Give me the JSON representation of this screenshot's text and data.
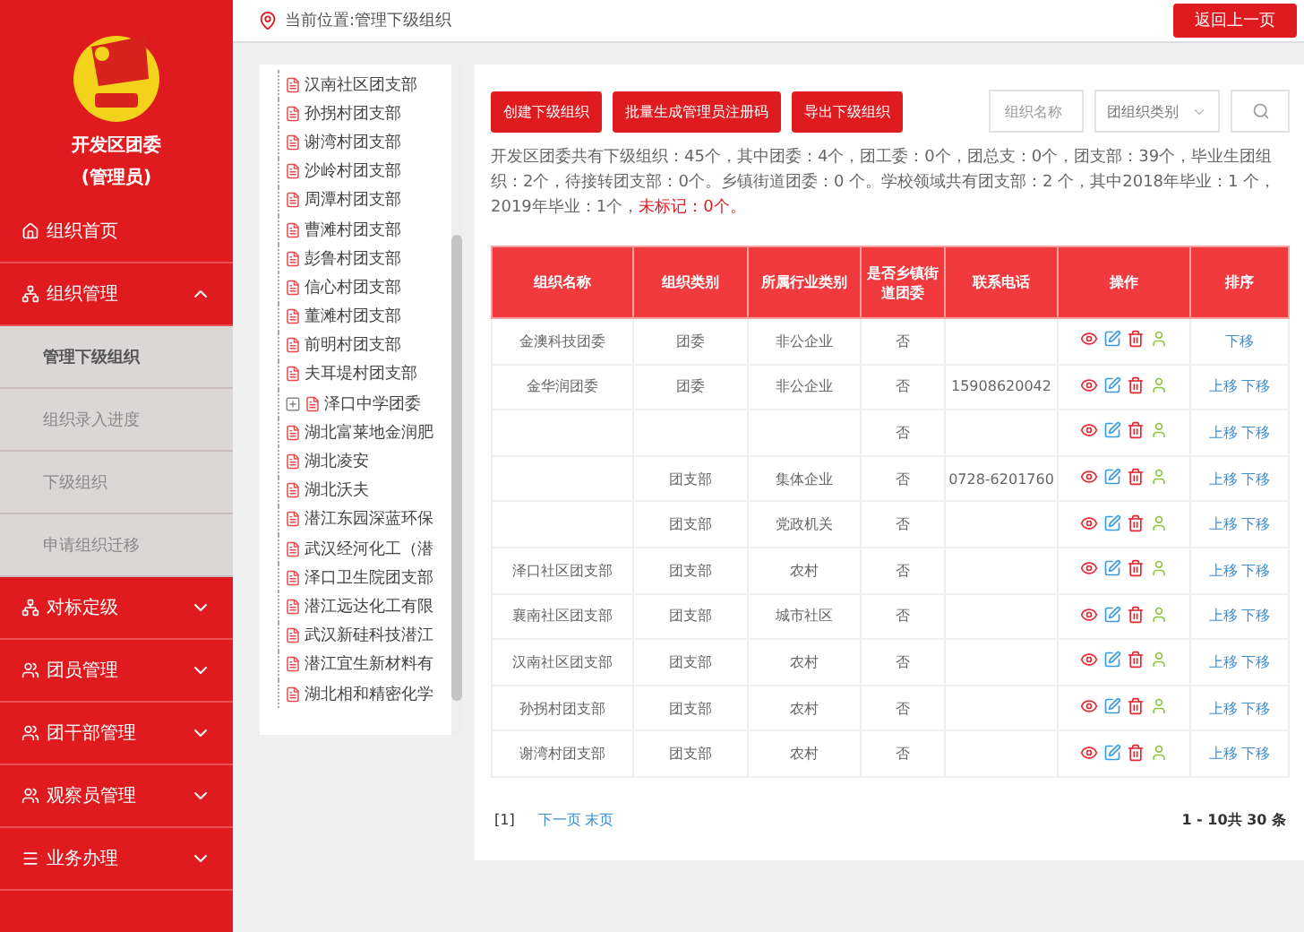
{
  "sidebar": {
    "org_name": "开发区团委",
    "role": "(管理员)",
    "items": [
      {
        "label": "组织首页"
      },
      {
        "label": "组织管理",
        "expanded": true,
        "children": [
          {
            "label": "管理下级组织",
            "selected": true
          },
          {
            "label": "组织录入进度",
            "selected": false
          },
          {
            "label": "下级组织",
            "selected": false
          },
          {
            "label": "申请组织迁移",
            "selected": false
          }
        ]
      },
      {
        "label": "对标定级",
        "expanded": false
      },
      {
        "label": "团员管理",
        "expanded": false
      },
      {
        "label": "团干部管理",
        "expanded": false
      },
      {
        "label": "观察员管理",
        "expanded": false
      },
      {
        "label": "业务办理",
        "expanded": false
      }
    ]
  },
  "topbar": {
    "location": "当前位置:管理下级组织",
    "back_button": "返回上一页"
  },
  "tree": [
    {
      "label": "汉南社区团支部"
    },
    {
      "label": "孙拐村团支部"
    },
    {
      "label": "谢湾村团支部"
    },
    {
      "label": "沙岭村团支部"
    },
    {
      "label": "周潭村团支部"
    },
    {
      "label": "曹滩村团支部"
    },
    {
      "label": "彭鲁村团支部"
    },
    {
      "label": "信心村团支部"
    },
    {
      "label": "董滩村团支部"
    },
    {
      "label": "前明村团支部"
    },
    {
      "label": "夫耳堤村团支部"
    },
    {
      "label": "泽口中学团委",
      "expanded": false
    },
    {
      "label": "湖北富莱地金润肥"
    },
    {
      "label": "湖北凌安"
    },
    {
      "label": "湖北沃夫"
    },
    {
      "label": "潜江东园深蓝环保"
    },
    {
      "label": "武汉经河化工（潜"
    },
    {
      "label": "泽口卫生院团支部"
    },
    {
      "label": "潜江远达化工有限"
    },
    {
      "label": "武汉新硅科技潜江"
    },
    {
      "label": "潜江宜生新材料有"
    },
    {
      "label": "湖北相和精密化学"
    }
  ],
  "toolbar": {
    "buttons": [
      "创建下级组织",
      "批量生成管理员注册码",
      "导出下级组织"
    ],
    "name_placeholder": "组织名称",
    "type_select": "团组织类别"
  },
  "summary": "开发区团委共有下级组织：45个，其中团委：4个，团工委：0个，团总支：0个，团支部：39个，毕业生团组织：2个，待接转团支部：0个。乡镇街道团委：0 个。学校领域共有团支部：2 个，其中2018年毕业：1 个，2019年毕业：1个，",
  "unmarked": "未标记：0个。",
  "table": {
    "columns": [
      "组织名称",
      "组织类别",
      "所属行业类别",
      "是否乡镇街道团委",
      "联系电话",
      "操作",
      "排序"
    ],
    "rows": [
      {
        "cells": [
          "金澳科技团委",
          "团委",
          "非公企业",
          "否",
          ""
        ],
        "sort": [
          "下移"
        ]
      },
      {
        "cells": [
          "金华润团委",
          "团委",
          "非公企业",
          "否",
          "15908620042"
        ],
        "sort": [
          "上移",
          "下移"
        ]
      },
      {
        "cells": [
          "",
          "",
          "",
          "否",
          ""
        ],
        "sort": [
          "上移",
          "下移"
        ]
      },
      {
        "cells": [
          "",
          "团支部",
          "集体企业",
          "否",
          "0728-6201760"
        ],
        "sort": [
          "上移",
          "下移"
        ]
      },
      {
        "cells": [
          "",
          "团支部",
          "党政机关",
          "否",
          ""
        ],
        "sort": [
          "上移",
          "下移"
        ]
      },
      {
        "cells": [
          "泽口社区团支部",
          "团支部",
          "农村",
          "否",
          ""
        ],
        "sort": [
          "上移",
          "下移"
        ]
      },
      {
        "cells": [
          "襄南社区团支部",
          "团支部",
          "城市社区",
          "否",
          ""
        ],
        "sort": [
          "上移",
          "下移"
        ]
      },
      {
        "cells": [
          "汉南社区团支部",
          "团支部",
          "农村",
          "否",
          ""
        ],
        "sort": [
          "上移",
          "下移"
        ]
      },
      {
        "cells": [
          "孙拐村团支部",
          "团支部",
          "农村",
          "否",
          ""
        ],
        "sort": [
          "上移",
          "下移"
        ]
      },
      {
        "cells": [
          "谢湾村团支部",
          "团支部",
          "农村",
          "否",
          ""
        ],
        "sort": [
          "上移",
          "下移"
        ]
      }
    ]
  },
  "pagination": {
    "current": "[1]",
    "links": [
      "下一页",
      "末页"
    ],
    "count": "1 - 10共 30 条"
  }
}
